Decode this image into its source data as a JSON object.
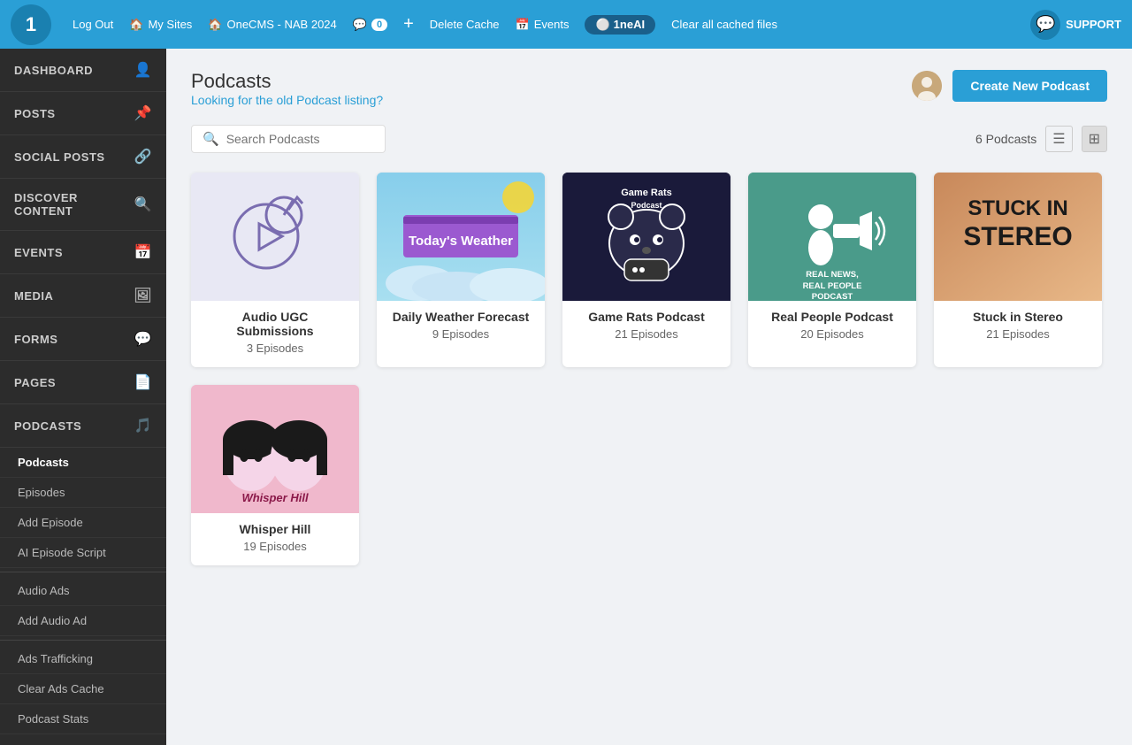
{
  "topnav": {
    "logout": "Log Out",
    "mysites": "My Sites",
    "onecms": "OneCMS - NAB 2024",
    "comments": "0",
    "delete_cache": "Delete Cache",
    "events": "Events",
    "ai_logo": "1neAI",
    "clear_cached": "Clear all cached files",
    "support": "SUPPORT"
  },
  "sidebar": {
    "dashboard": "DASHBOARD",
    "posts": "POSTS",
    "social_posts": "SOCIAL POSTS",
    "discover_content": "DISCOVER CONTENT",
    "events": "EVENTS",
    "media": "MEDIA",
    "forms": "FORMS",
    "pages": "PAGES",
    "podcasts": "PODCASTS",
    "sub_podcasts": "Podcasts",
    "sub_episodes": "Episodes",
    "sub_add_episode": "Add Episode",
    "sub_ai_script": "AI Episode Script",
    "sub_audio_ads": "Audio Ads",
    "sub_add_audio": "Add Audio Ad",
    "sub_ads_trafficking": "Ads Trafficking",
    "sub_clear_cache": "Clear Ads Cache",
    "sub_podcast_stats": "Podcast Stats"
  },
  "page": {
    "title": "Podcasts",
    "old_listing_link": "Looking for the old Podcast listing?",
    "create_btn": "Create New Podcast",
    "search_placeholder": "Search Podcasts",
    "podcast_count": "6 Podcasts"
  },
  "podcasts": [
    {
      "id": "ugc",
      "name": "Audio UGC Submissions",
      "episodes": "3 Episodes",
      "thumb_type": "ugc"
    },
    {
      "id": "weather",
      "name": "Daily Weather Forecast",
      "episodes": "9 Episodes",
      "thumb_type": "weather"
    },
    {
      "id": "gamerats",
      "name": "Game Rats Podcast",
      "episodes": "21 Episodes",
      "thumb_type": "gamerats"
    },
    {
      "id": "realnews",
      "name": "Real People Podcast",
      "episodes": "20 Episodes",
      "thumb_type": "realnews"
    },
    {
      "id": "stereo",
      "name": "Stuck in Stereo",
      "episodes": "21 Episodes",
      "thumb_type": "stereo"
    },
    {
      "id": "whisper",
      "name": "Whisper Hill",
      "episodes": "19 Episodes",
      "thumb_type": "whisper"
    }
  ]
}
